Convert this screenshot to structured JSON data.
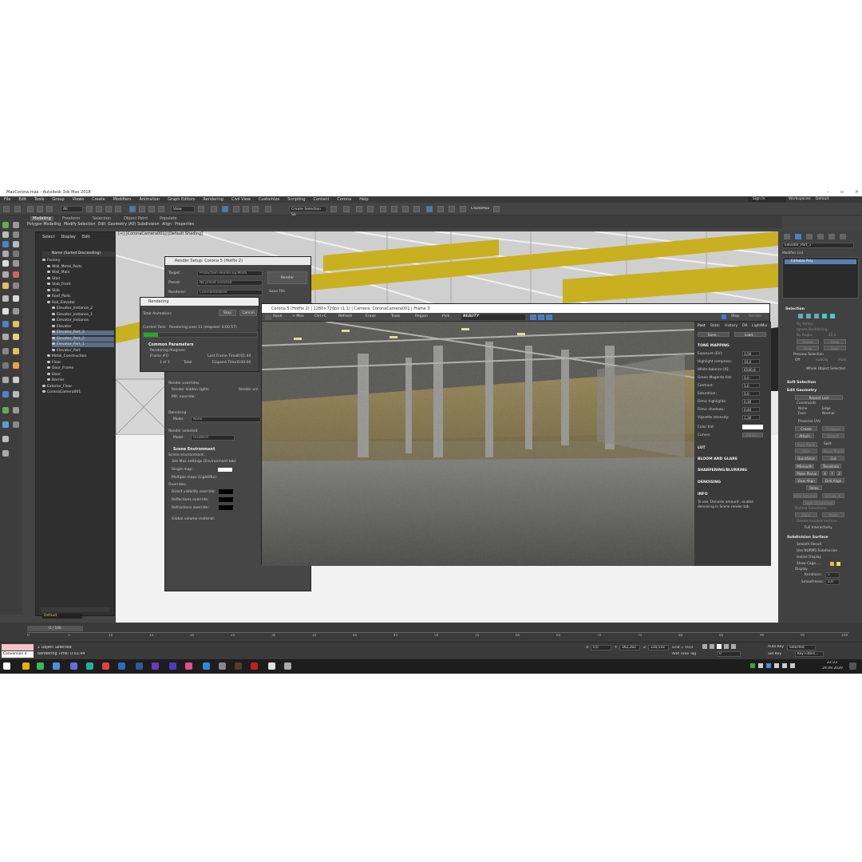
{
  "window": {
    "title": "MaxCorona.max - Autodesk 3ds Max 2018"
  },
  "menu": [
    "File",
    "Edit",
    "Tools",
    "Group",
    "Views",
    "Create",
    "Modifiers",
    "Animation",
    "Graph Editors",
    "Rendering",
    "Civil View",
    "Customize",
    "Scripting",
    "Content",
    "Corona",
    "Help"
  ],
  "signin": "Sign In",
  "workspaces": {
    "label": "Workspaces:",
    "value": "Default"
  },
  "toolbar": {
    "filter": "All",
    "view": "View",
    "selection_set": "Create Selection Se",
    "ctrl": "C4DtoMax"
  },
  "ribbon": {
    "tabs": [
      "Modeling",
      "Freeform",
      "Selection",
      "Object Paint",
      "Populate"
    ],
    "subtabs": [
      "Polygon Modeling",
      "Modify Selection",
      "Edit",
      "Geometry (All)",
      "Subdivision",
      "Align",
      "Properties"
    ]
  },
  "explorer": {
    "tabs": [
      "Select",
      "Display",
      "Edit"
    ],
    "header": "Name (Sorted Descending)",
    "rows": [
      {
        "label": "Factory",
        "indent": 0
      },
      {
        "label": "Wall_Metal_Parts",
        "indent": 1
      },
      {
        "label": "Wall_Main",
        "indent": 1
      },
      {
        "label": "Stair",
        "indent": 1
      },
      {
        "label": "Slab_Front",
        "indent": 1
      },
      {
        "label": "Slab",
        "indent": 1
      },
      {
        "label": "Roof_Parts",
        "indent": 1
      },
      {
        "label": "Rail_Elevator",
        "indent": 1
      },
      {
        "label": "Elevator_Instance_2",
        "indent": 2
      },
      {
        "label": "Elevator_Instance_1",
        "indent": 2
      },
      {
        "label": "Elevator_Instance",
        "indent": 2
      },
      {
        "label": "Elevator",
        "indent": 2
      },
      {
        "label": "Elevator_Part_3",
        "indent": 2
      },
      {
        "label": "Elevator_Part_2",
        "indent": 2
      },
      {
        "label": "Elevator_Part_1",
        "indent": 2
      },
      {
        "label": "Elevator_Part",
        "indent": 2
      },
      {
        "label": "Metal_Construction",
        "indent": 1
      },
      {
        "label": "Floor",
        "indent": 1
      },
      {
        "label": "Door_Frame",
        "indent": 1
      },
      {
        "label": "Door",
        "indent": 1
      },
      {
        "label": "Barrier",
        "indent": 1
      },
      {
        "label": "Exterior_Floor",
        "indent": 0
      },
      {
        "label": "CoronaCamera001",
        "indent": 0
      }
    ],
    "layer": "Default"
  },
  "render_setup": {
    "title": "Render Setup: Corona 5 (Hotfix 2)",
    "target_label": "Target:",
    "target": "Production Rendering Mode",
    "preset_label": "Preset:",
    "preset": "No preset selected",
    "renderer_label": "Renderer:",
    "renderer": "CoronaRenderer",
    "render_btn": "Render",
    "save_file": "Save File",
    "render_overrides": "Render overrides",
    "render_hidden": "Render hidden lights",
    "render_only": "Render onl",
    "mtl_override": "Mtl. override:",
    "denoising": "Denoising",
    "mode_label": "Mode:",
    "mode": "None",
    "render_selected": "Render selected",
    "mode2": "Disabled",
    "scene_env": "Scene Environment",
    "scene_env_sub": "Scene environment:",
    "opt1": "3ds Max settings (Environment tab)",
    "opt2": "Single map:",
    "opt3": "Multiple maps (LightMix):",
    "overrides": "Overrides",
    "ov1": "Direct visibility override:",
    "ov2": "Reflections override:",
    "ov3": "Refractions override:",
    "global_vol": "Global volume material:"
  },
  "rendering": {
    "title": "Rendering",
    "total_anim": "Total Animation:",
    "stop": "Stop",
    "cancel": "Cancel",
    "current_task_label": "Current Task:",
    "current_task": "Rendering pass 11 (elapsed: 0:00:57)",
    "progress": 0.13,
    "common": "Common Parameters",
    "progress_label": "Rendering Progress:",
    "frame_label": "Frame #",
    "frame": "0",
    "of": "1 of 1",
    "total": "Total",
    "last_frame_label": "Last Frame Time:",
    "last_frame": "0:01:44",
    "elapsed_label": "Elapsed Time:",
    "elapsed": "0:00:00"
  },
  "vfb": {
    "title": "Corona 5 (Hotfix 2) | 1280×720px (1:1) | Camera: CoronaCamera001 | Frame 0",
    "tools": [
      "Save",
      "> Max",
      "Ctrl+C",
      "Refresh",
      "Erase",
      "Tools",
      "Region",
      "Pick"
    ],
    "channel": "BEAUTY",
    "stop": "Stop",
    "render": "Render",
    "tabs": [
      "Post",
      "Stats",
      "History",
      "DR",
      "LightMix"
    ],
    "save": "Save...",
    "load": "Load...",
    "tone_mapping": "TONE MAPPING",
    "params": [
      {
        "label": "Exposure (EV):",
        "value": "3,50"
      },
      {
        "label": "Highlight compress:",
        "value": "10,0"
      },
      {
        "label": "White balance [K]:",
        "value": "6500,0"
      },
      {
        "label": "Green-Magenta tint:",
        "value": "0,0"
      },
      {
        "label": "Contrast:",
        "value": "5,0"
      },
      {
        "label": "Saturation:",
        "value": "0,0"
      },
      {
        "label": "Filmic highlights:",
        "value": "0,30"
      },
      {
        "label": "Filmic shadows:",
        "value": "0,40"
      },
      {
        "label": "Vignette intensity:",
        "value": "1,30"
      }
    ],
    "color_tint": "Color tint:",
    "curves": "Curves:",
    "editor": "Editor...",
    "lut": "LUT",
    "bloom": "BLOOM AND GLARE",
    "sharpen": "SHARPENING/BLURRING",
    "denoise": "DENOISING",
    "info": "INFO",
    "info_text": "To use 'Denoise amount', enable denoising in Scene render tab."
  },
  "cmdpanel": {
    "object": "Elevator_Part_1",
    "modifier_list": "Modifier List",
    "stack_item": "Editable Poly",
    "selection": "Selection",
    "by_vertex": "By Vertex",
    "ignore_backfacing": "Ignore Backfacing",
    "by_angle": "By Angle:",
    "angle": "45,0",
    "shrink": "Shrink",
    "grow": "Grow",
    "ring": "Ring",
    "loop": "Loop",
    "preview": "Preview Selection",
    "off": "Off",
    "subobj": "SubObj",
    "multi": "Multi",
    "whole": "Whole Object Selected",
    "soft_sel": "Soft Selection",
    "edit_geo": "Edit Geometry",
    "repeat": "Repeat Last",
    "constraints": "Constraints",
    "none": "None",
    "edge": "Edge",
    "face": "Face",
    "normal": "Normal",
    "preserve": "Preserve UVs",
    "create": "Create",
    "collapse": "Collapse",
    "attach": "Attach",
    "detach": "Detach",
    "slice_plane": "Slice Plane",
    "split": "Split",
    "slice": "Slice",
    "reset_plane": "Reset Plane",
    "quickslice": "QuickSlice",
    "cut": "Cut",
    "msmooth": "MSmooth",
    "tessellate": "Tessellate",
    "make_planar": "Make Planar",
    "x": "X",
    "y": "Y",
    "z": "Z",
    "view_align": "View Align",
    "grid_align": "Grid Align",
    "relax": "Relax",
    "hide_sel": "Hide Selected",
    "unhide_all": "Unhide All",
    "hide_unsel": "Hide Unselected",
    "named_sel": "Named Selections:",
    "copy": "Copy",
    "paste": "Paste",
    "del_iso": "Delete Isolated Vertices",
    "full_inter": "Full Interactivity",
    "subdiv": "Subdivision Surface",
    "smooth_result": "Smooth Result",
    "nurms": "Use NURMS Subdivision",
    "isoline": "Isoline Display",
    "show_cage": "Show Cage......",
    "display": "Display",
    "iterations": "Iterations:",
    "iter_val": "1",
    "smoothness": "Smoothness:",
    "smooth_val": "1,0"
  },
  "timeline": {
    "frame": "0 / 100",
    "ticks": [
      "0",
      "5",
      "10",
      "15",
      "20",
      "25",
      "30",
      "35",
      "40",
      "45",
      "50",
      "55",
      "60",
      "65",
      "70",
      "75",
      "80",
      "85",
      "90",
      "95",
      "100"
    ]
  },
  "status": {
    "selected": "1 Object Selected",
    "rendertime": "Rendering Time: 0:01:44",
    "script": "Conversion d",
    "x": "0,0",
    "y": "362,282",
    "z": "318,518",
    "grid": "Grid = 10,0",
    "add_tag": "Add Time Tag",
    "autokey": "Auto Key",
    "selected_dd": "Selected",
    "setkey": "Set Key",
    "keyfilters": "Key Filters...",
    "frame_field": "0"
  },
  "taskbar": {
    "time": "22:23",
    "date": "29.09.2020"
  }
}
